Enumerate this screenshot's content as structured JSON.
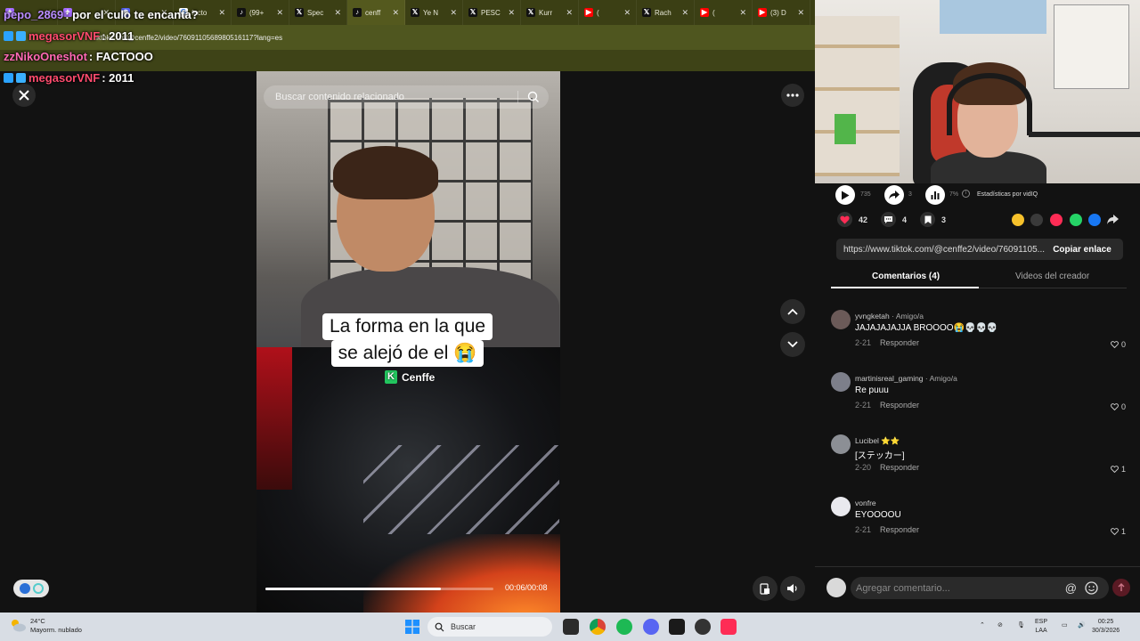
{
  "chat": {
    "messages": [
      {
        "user": "pepo_2869",
        "text": ": por el culo te encanta?",
        "color": "#b98cff"
      },
      {
        "user": "megasorVNF",
        "text": ": 2011",
        "color": "#ff4b6e"
      },
      {
        "user": "zzNikoOneshot",
        "text": ": FACTOOO",
        "color": "#ff69b4"
      },
      {
        "user": "megasorVNF",
        "text": ": 2011",
        "color": "#ff4b6e"
      }
    ]
  },
  "browser": {
    "tabs": [
      {
        "title": "",
        "icon": "sparkle-icon"
      },
      {
        "title": "",
        "icon": "sparkle-icon"
      },
      {
        "title": "",
        "icon": "discord-icon"
      },
      {
        "title": "facto",
        "icon": "google-icon"
      },
      {
        "title": "(99+",
        "icon": "tiktok-icon"
      },
      {
        "title": "Spec",
        "icon": "x-icon"
      },
      {
        "title": "cenff",
        "icon": "tiktok-icon"
      },
      {
        "title": "Ye N",
        "icon": "x-icon"
      },
      {
        "title": "PESC",
        "icon": "x-icon"
      },
      {
        "title": "Kurr",
        "icon": "x-icon"
      },
      {
        "title": "(",
        "icon": "youtube-icon"
      },
      {
        "title": "Rach",
        "icon": "x-icon"
      },
      {
        "title": "(",
        "icon": "youtube-icon"
      },
      {
        "title": "(3) D",
        "icon": "youtube-icon"
      }
    ],
    "url": "tiktok.com/@cenffe2/video/7609110568980516117?lang=es"
  },
  "player": {
    "search_placeholder": "Buscar contenido relacionado",
    "caption_line1": "La forma en la que",
    "caption_line2": "se alejó de el 😭",
    "watermark": "Cenffe",
    "time": "00:06/00:08",
    "progress": 0.77
  },
  "stats": {
    "plays": "735",
    "shares_small": "3",
    "pct": "7%",
    "statistics_label": "Estadísticas por vidIQ",
    "likes": "42",
    "comments": "4",
    "saves": "3"
  },
  "link": {
    "url": "https://www.tiktok.com/@cenffe2/video/76091105...",
    "copy_label": "Copiar enlace"
  },
  "tabs": {
    "comments": "Comentarios (4)",
    "creator_videos": "Videos del creador"
  },
  "comments": [
    {
      "user": "yvngketah",
      "tag": " · Amigo/a",
      "text": "JAJAJAJAJJA BROOOO😭💀💀💀",
      "date": "2-21",
      "reply": "Responder",
      "likes": "0",
      "avatar": "#6b5a58"
    },
    {
      "user": "martinisreal_gaming",
      "tag": " · Amigo/a",
      "text": "Re puuu",
      "date": "2-21",
      "reply": "Responder",
      "likes": "0",
      "avatar": "#7d7f8a"
    },
    {
      "user": "Lucibel ⭐⭐",
      "tag": "",
      "text": "[ステッカー]",
      "date": "2-20",
      "reply": "Responder",
      "likes": "1",
      "avatar": "#8c8f95"
    },
    {
      "user": "vonfre",
      "tag": "",
      "text": "EYOOOOU",
      "date": "2-21",
      "reply": "Responder",
      "likes": "1",
      "avatar": "#e9e9ee"
    }
  ],
  "composer": {
    "placeholder": "Agregar comentario..."
  },
  "taskbar": {
    "temp": "24°C",
    "weather": "Mayorm. nublado",
    "search": "Buscar",
    "lang1": "ESP",
    "lang2": "LAA",
    "time": "00:25",
    "date": "30/3/2026"
  }
}
